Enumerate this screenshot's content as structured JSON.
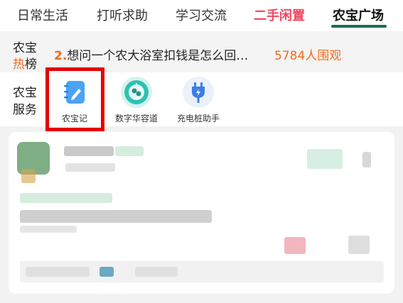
{
  "tabs": [
    {
      "label": "日常生活"
    },
    {
      "label": "打听求助"
    },
    {
      "label": "学习交流"
    },
    {
      "label": "二手闲置"
    },
    {
      "label": "农宝广场"
    }
  ],
  "hot": {
    "label_line1": "农宝",
    "label_line2_red": "热",
    "label_line2_black": "榜",
    "rank": "2.",
    "text": "想问一个农大浴室扣钱是怎么回…",
    "count": "5784人围观"
  },
  "services": {
    "label_line1": "农宝",
    "label_line2": "服务",
    "items": [
      {
        "label": "农宝记",
        "icon": "notebook-pen-icon"
      },
      {
        "label": "数字华容道",
        "icon": "puzzle-clock-icon"
      },
      {
        "label": "充电桩助手",
        "icon": "charging-plug-icon"
      }
    ]
  },
  "colors": {
    "accent_red": "#f04860",
    "hot_orange": "#f26b1d",
    "tab_underline": "#1f6b4a",
    "highlight_box": "#e50000"
  }
}
